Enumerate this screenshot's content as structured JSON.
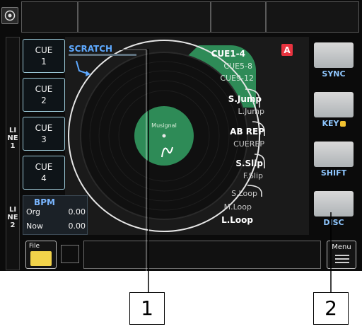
{
  "cue_buttons": [
    {
      "label": "CUE\n1"
    },
    {
      "label": "CUE\n2"
    },
    {
      "label": "CUE\n3"
    },
    {
      "label": "CUE\n4"
    }
  ],
  "scratch_label": "SCRATCH",
  "line_labels": [
    "LINE1",
    "LINE2"
  ],
  "bpm": {
    "title": "BPM",
    "org_label": "Org",
    "org_value": "0.00",
    "now_label": "Now",
    "now_value": "0.00"
  },
  "disc_label": "Musignal",
  "deck_badge": "A",
  "pad_modes": [
    {
      "primary": "CUE1-4",
      "secondary": [
        "CUE5-8",
        "CUE9-12"
      ]
    },
    {
      "primary": "S.Jump",
      "secondary": [
        "L.Jump"
      ]
    },
    {
      "primary": "AB REP",
      "secondary": [
        "CUEREP"
      ]
    },
    {
      "primary": "S.Slip",
      "secondary": [
        "F.Slip"
      ]
    },
    {
      "primary": "L.Loop",
      "secondary": [
        "S.Loop",
        "M.Loop"
      ]
    }
  ],
  "side_buttons": [
    {
      "label": "SYNC"
    },
    {
      "label": "KEY"
    },
    {
      "label": "SHIFT"
    },
    {
      "label": "DISC"
    }
  ],
  "file_label": "File",
  "menu_label": "Menu",
  "callouts": [
    "1",
    "2"
  ],
  "colors": {
    "accent_green": "#2e8b57",
    "scratch_blue": "#5ea9ff",
    "badge_red": "#e8333f",
    "label_blue": "#8fc7ff",
    "cue_border": "#9cc9d8",
    "folder_yellow": "#f2d34a"
  }
}
